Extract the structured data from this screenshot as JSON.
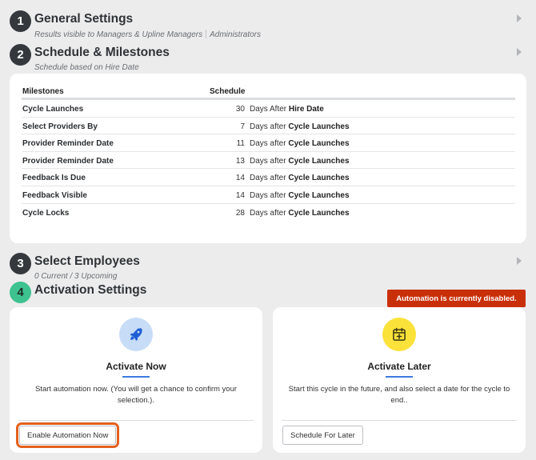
{
  "steps": [
    {
      "number": "1",
      "title": "General Settings",
      "subtitle_parts": [
        "Results visible to Managers & Upline Managers",
        "Administrators"
      ]
    },
    {
      "number": "2",
      "title": "Schedule & Milestones",
      "subtitle": "Schedule based on Hire Date"
    },
    {
      "number": "3",
      "title": "Select Employees",
      "subtitle": "0 Current / 3 Upcoming"
    },
    {
      "number": "4",
      "title": "Activation Settings"
    }
  ],
  "milestones_table": {
    "headers": {
      "milestone": "Milestones",
      "schedule": "Schedule"
    },
    "rows": [
      {
        "name": "Cycle Launches",
        "days": "30",
        "unit": "Days After",
        "reference": "Hire Date"
      },
      {
        "name": "Select Providers By",
        "days": "7",
        "unit": "Days after",
        "reference": "Cycle Launches"
      },
      {
        "name": "Provider Reminder Date",
        "days": "11",
        "unit": "Days after",
        "reference": "Cycle Launches"
      },
      {
        "name": "Provider Reminder Date",
        "days": "13",
        "unit": "Days after",
        "reference": "Cycle Launches"
      },
      {
        "name": "Feedback Is Due",
        "days": "14",
        "unit": "Days after",
        "reference": "Cycle Launches"
      },
      {
        "name": "Feedback Visible",
        "days": "14",
        "unit": "Days after",
        "reference": "Cycle Launches"
      },
      {
        "name": "Cycle Locks",
        "days": "28",
        "unit": "Days after",
        "reference": "Cycle Launches"
      }
    ]
  },
  "automation_badge": "Automation is currently disabled.",
  "activate_now": {
    "title": "Activate Now",
    "description": "Start automation now. (You will get a chance to confirm your selection.).",
    "button": "Enable Automation Now",
    "icon": "rocket-icon",
    "icon_bg": "#c7dcf6",
    "icon_color": "#1f5fd6"
  },
  "activate_later": {
    "title": "Activate Later",
    "description": "Start this cycle in the future, and also select a date for the cycle to end..",
    "button": "Schedule For Later",
    "icon": "calendar-plus-icon",
    "icon_bg": "#fbe23a",
    "icon_color": "#3a3410"
  },
  "colors": {
    "badge": "#c9300a",
    "highlight": "#e4601d",
    "step_active": "#3ec28f",
    "accent": "#3d7ae0"
  }
}
